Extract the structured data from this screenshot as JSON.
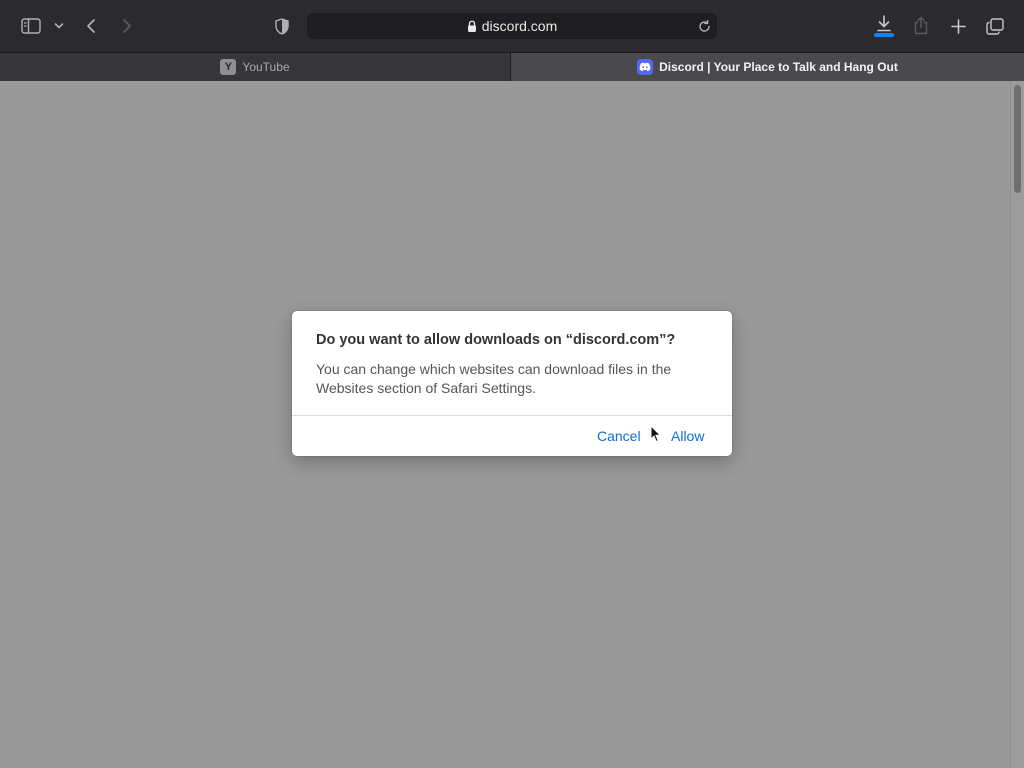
{
  "browser": {
    "address": "discord.com",
    "tabs": [
      {
        "label": "YouTube",
        "favicon_letter": "Y",
        "active": false
      },
      {
        "label": "Discord | Your Place to Talk and Hang Out",
        "active": true
      }
    ]
  },
  "dialog": {
    "title": "Do you want to allow downloads on “discord.com”?",
    "message": "You can change which websites can download files in the Websites section of Safari Settings.",
    "cancel_label": "Cancel",
    "allow_label": "Allow"
  },
  "colors": {
    "accent": "#0a84ff",
    "link": "#0a6fd0",
    "discord_brand": "#5865f2",
    "page_dim": "#999999"
  },
  "icons": [
    "sidebar-icon",
    "chevron-down-icon",
    "back-icon",
    "forward-icon",
    "privacy-shield-icon",
    "lock-icon",
    "reload-icon",
    "download-icon",
    "share-icon",
    "new-tab-icon",
    "tab-overview-icon",
    "discord-favicon",
    "youtube-favicon",
    "mouse-cursor-icon"
  ]
}
